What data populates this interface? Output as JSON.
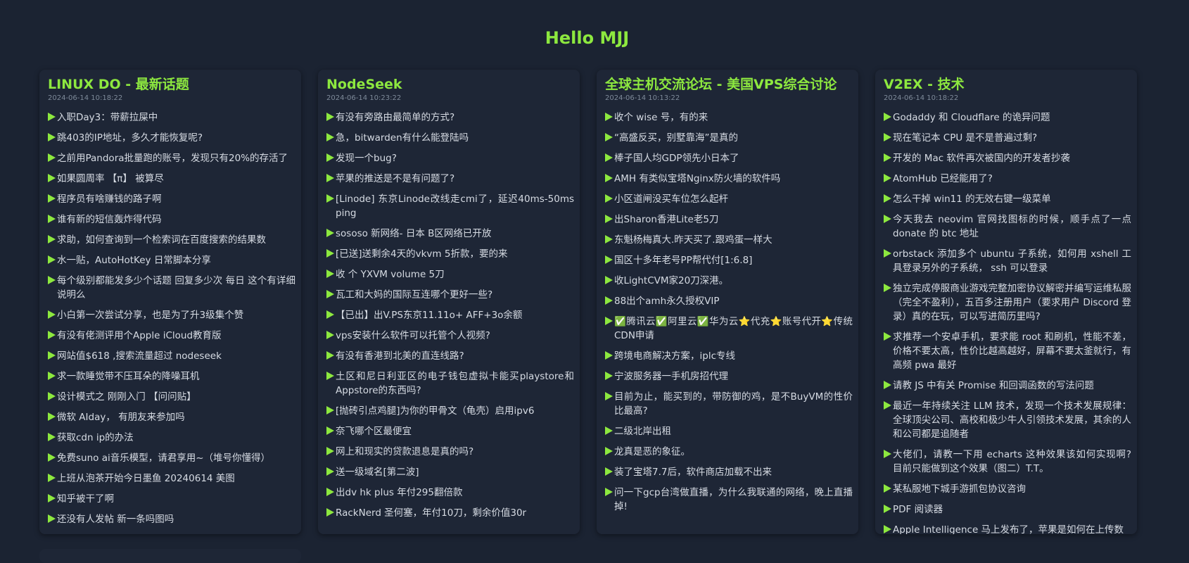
{
  "page": {
    "title": "Hello MJJ"
  },
  "colors": {
    "background": "#1b2332",
    "card": "#1e2636",
    "accent": "#8de83f",
    "text": "#d6dbe3",
    "muted": "#7e8a99"
  },
  "icons": {
    "bullet": "triangle-bullet-icon"
  },
  "columns": [
    {
      "title": "LINUX DO - 最新话题",
      "time": "2024-06-14 10:18:22",
      "items": [
        "入职Day3：带薪拉屎中",
        "跳403的IP地址，多久才能恢复呢?",
        "之前用Pandora批量跑的账号，发现只有20%的存活了",
        "如果圆周率 【π】 被算尽",
        "程序员有啥赚钱的路子啊",
        "谁有新的短信轰炸得代码",
        "求助，如何查询到一个检索词在百度搜索的结果数",
        "水一贴，AutoHotKey 日常脚本分享",
        "每个级别都能发多少个话题 回复多少次 每日 这个有详细说明么",
        "小白第一次尝试分享，也是为了升3级集个赞",
        "有没有佬测评用个Apple iCloud教育版",
        "网站值$618 ,搜索流量超过 nodeseek",
        "求一款睡觉带不压耳朵的降噪耳机",
        "设计模式之 刚刚入门 【问问贴】",
        "微软 AIday， 有朋友来参加吗",
        "获取cdn ip的办法",
        "免费suno ai音乐模型，请君享用~（堆号你懂得）",
        "上班从泡茶开始今日墨鱼 20240614 美图",
        "知乎被干了啊",
        "还没有人发帖 新一条吗图吗"
      ]
    },
    {
      "title": "NodeSeek",
      "time": "2024-06-14 10:23:22",
      "items": [
        "有没有旁路由最简单的方式?",
        "急，bitwarden有什么能登陆吗",
        "发现一个bug?",
        "苹果的推送是不是有问题了?",
        "[Linode] 东京Linode改线走cmi了，延迟40ms-50ms ping",
        "sososo 新网络- 日本 B区网络已开放",
        "[已送]送剩余4天的vkvm 5折款，要的来",
        "收 个 YXVM volume 5刀",
        "瓦工和大妈的国际互连哪个更好一些?",
        "【已出】出V.PS东京11.11o+ AFF+3o余额",
        "vps安装什么软件可以托管个人视频?",
        "有没有香港到北美的直连线路?",
        "土区和尼日利亚区的电子钱包虚拟卡能买playstore和Appstore的东西吗?",
        "[抛砖引点鸡腿]为你的甲骨文（龟壳）启用ipv6",
        "奈飞哪个区最便宜",
        "网上和现实的贷款退息是真的吗?",
        "送一级域名[第二波]",
        "出dv hk plus 年付295翻倍款",
        "RackNerd 圣何塞，年付10刀，剩余价值30r"
      ]
    },
    {
      "title": "全球主机交流论坛 - 美国VPS综合讨论",
      "time": "2024-06-14 10:13:22",
      "items": [
        "收个 wise 号，有的来",
        "“高盛反买，别墅靠海”是真的",
        "棒子国人均GDP领先小日本了",
        "AMH 有类似宝塔Nginx防火墙的软件吗",
        "小区道闸没买车位怎么起杆",
        "出Sharon香港Lite老5刀",
        "东魁杨梅真大.昨天买了.跟鸡蛋一样大",
        "国区十多年老号PP帮代付[1:6.8]",
        "收LightCVM家20刀深港。",
        "88出个amh永久授权VIP",
        "✅腾讯云✅阿里云✅华为云⭐代充⭐账号代开⭐传统CDN申请",
        "跨境电商解决方案，iplc专线",
        "宁波服务器一手机房招代理",
        "目前为止，能买到的，带防御的鸡，是不BuyVM的性价比最高?",
        "二级北岸出租",
        "龙真是恶的象征。",
        "装了宝塔7.7后，软件商店加载不出来",
        "问一下gcp台湾做直播，为什么我联通的网络，晚上直播掉!"
      ]
    },
    {
      "title": "V2EX - 技术",
      "time": "2024-06-14 10:18:22",
      "items": [
        "Godaddy 和 Cloudflare 的诡异问题",
        "现在笔记本 CPU 是不是普遍过剩?",
        "开发的 Mac 软件再次被国内的开发者抄袭",
        "AtomHub 已经能用了?",
        "怎么干掉 win11 的无效右键一级菜单",
        "今天我去 neovim 官网找图标的时候，顺手点了一点 donate 的 btc 地址",
        "orbstack 添加多个 ubuntu 子系统，如何用 xshell 工具登录另外的子系统， ssh 可以登录",
        "独立完成停服商业游戏完整加密协议解密并编写运维私服（完全不盈利），五百多注册用户（要求用户 Discord 登录）真的在玩，可以写进简历里吗?",
        "求推荐一个安卓手机，要求能 root 和刷机，性能不差，价格不要太高，性价比越高越好，屏幕不要太釜就行，有高频 pwa 最好",
        "请教 JS 中有关 Promise 和回调函数的写法问题",
        "最近一年持续关注 LLM 技术，发现一个技术发展规律： 全球顶尖公司、高校和极少牛人引领技术发展，其余的人和公司都是追随者",
        "大佬们，请教一下用 echarts 这种效果该如何实现啊? 目前只能做到这个效果（图二）T.T。",
        "某私服地下城手游抓包协议咨询",
        "PDF 阅读器",
        "Apple Intelligence 马上发布了，苹果是如何在上传数"
      ]
    }
  ]
}
